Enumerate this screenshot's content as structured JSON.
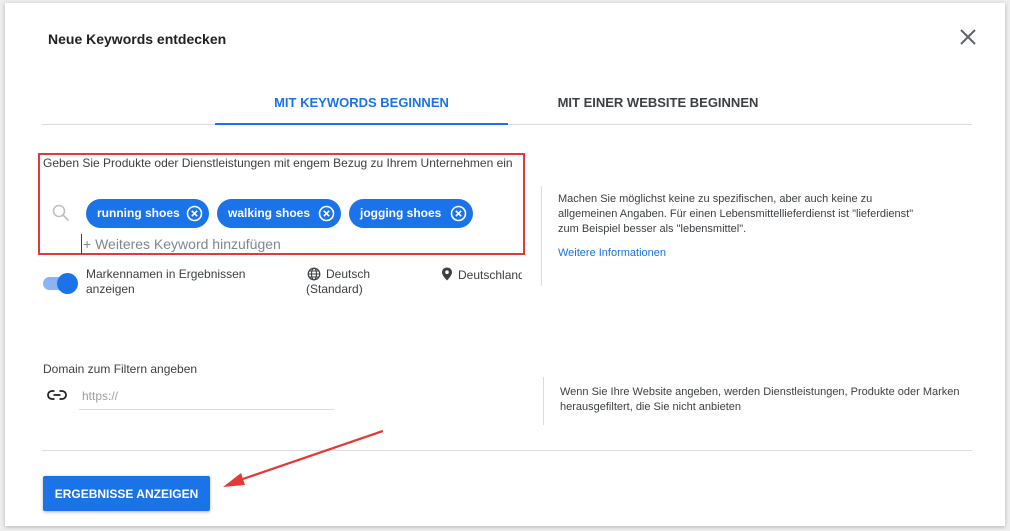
{
  "dialog": {
    "title": "Neue Keywords entdecken"
  },
  "tabs": [
    {
      "label": "MIT KEYWORDS BEGINNEN",
      "active": true
    },
    {
      "label": "MIT EINER WEBSITE BEGINNEN",
      "active": false
    }
  ],
  "keywords": {
    "label": "Geben Sie Produkte oder Dienstleistungen mit engem Bezug zu Ihrem Unternehmen ein",
    "chips": [
      "running shoes",
      "walking shoes",
      "jogging shoes"
    ],
    "add_placeholder": "+ Weiteres Keyword hinzufügen",
    "help_text": "Machen Sie möglichst keine zu spezifischen, aber auch keine zu allgemeinen Angaben. Für einen Lebensmittellieferdienst ist \"lieferdienst\" zum Beispiel besser als \"lebensmittel\".",
    "help_link": "Weitere Informationen"
  },
  "options": {
    "brand_toggle_label": "Markennamen in Ergebnissen anzeigen",
    "brand_toggle_on": true,
    "language_line1": "Deutsch",
    "language_line2": "(Standard)",
    "location": "Deutschland"
  },
  "domain": {
    "label": "Domain zum Filtern angeben",
    "placeholder": "https://",
    "help_text": "Wenn Sie Ihre Website angeben, werden Dienstleistungen, Produkte oder Marken herausgefiltert, die Sie nicht anbieten"
  },
  "submit": {
    "label": "ERGEBNISSE ANZEIGEN"
  },
  "colors": {
    "accent": "#1a73e8",
    "highlight_box": "#e53935",
    "annotation_arrow": "#e53935"
  }
}
